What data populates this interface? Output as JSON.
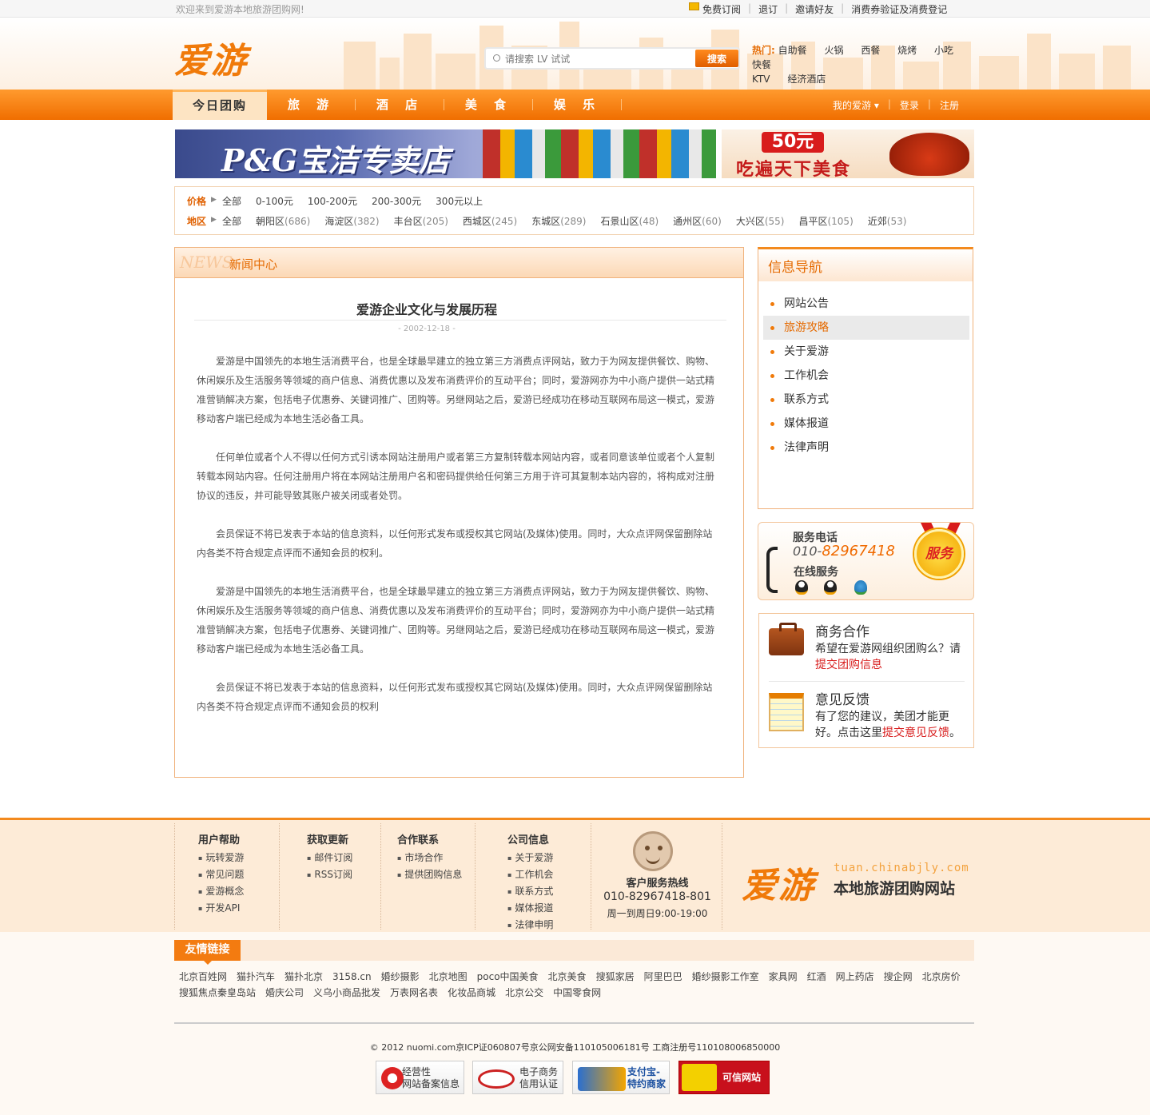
{
  "topbar": {
    "welcome": "欢迎来到爱游本地旅游团购网!",
    "links": [
      "免费订阅",
      "退订",
      "邀请好友",
      "消费券验证及消费登记"
    ]
  },
  "header": {
    "logo": "爱游",
    "search_placeholder": "请搜索 LV 试试",
    "search_button": "搜索",
    "hot_label": "热门:",
    "hot_words": [
      "自助餐",
      "火锅",
      "西餐",
      "烧烤",
      "小吃",
      "快餐",
      "KTV",
      "经济酒店"
    ]
  },
  "nav": {
    "items": [
      "今日团购",
      "旅 游",
      "酒 店",
      "美 食",
      "娱 乐"
    ],
    "right": [
      "我的爱游 ▾",
      "登录",
      "注册"
    ]
  },
  "banners": {
    "left": "P&G宝洁专卖店",
    "right_price": "50元",
    "right_text": "吃遍天下美食"
  },
  "filter": {
    "price_label": "价格",
    "price_options": [
      "全部",
      "0-100元",
      "100-200元",
      "200-300元",
      "300元以上"
    ],
    "area_label": "地区",
    "area_options": [
      {
        "name": "全部",
        "count": ""
      },
      {
        "name": "朝阳区",
        "count": "(686)"
      },
      {
        "name": "海淀区",
        "count": "(382)"
      },
      {
        "name": "丰台区",
        "count": "(205)"
      },
      {
        "name": "西城区",
        "count": "(245)"
      },
      {
        "name": "东城区",
        "count": "(289)"
      },
      {
        "name": "石景山区",
        "count": "(48)"
      },
      {
        "name": "通州区",
        "count": "(60)"
      },
      {
        "name": "大兴区",
        "count": "(55)"
      },
      {
        "name": "昌平区",
        "count": "(105)"
      },
      {
        "name": "近郊",
        "count": "(53)"
      }
    ]
  },
  "news": {
    "en": "NEWS",
    "header": "新闻中心",
    "title": "爱游企业文化与发展历程",
    "date": "- 2002-12-18 -",
    "paragraphs": [
      "爱游是中国领先的本地生活消费平台，也是全球最早建立的独立第三方消费点评网站，致力于为网友提供餐饮、购物、休闲娱乐及生活服务等领域的商户信息、消费优惠以及发布消费评价的互动平台；同时，爱游网亦为中小商户提供一站式精准营销解决方案，包括电子优惠券、关键词推广、团购等。另继网站之后，爱游已经成功在移动互联网布局这一模式，爱游移动客户端已经成为本地生活必备工具。",
      "任何单位或者个人不得以任何方式引诱本网站注册用户或者第三方复制转载本网站内容，或者同意该单位或者个人复制转载本网站内容。任何注册用户将在本网站注册用户名和密码提供给任何第三方用于许可其复制本站内容的，将构成对注册协议的违反，并可能导致其账户被关闭或者处罚。",
      "会员保证不将已发表于本站的信息资料，以任何形式发布或授权其它网站(及媒体)使用。同时，大众点评网保留删除站内各类不符合规定点评而不通知会员的权利。",
      "爱游是中国领先的本地生活消费平台，也是全球最早建立的独立第三方消费点评网站，致力于为网友提供餐饮、购物、休闲娱乐及生活服务等领域的商户信息、消费优惠以及发布消费评价的互动平台；同时，爱游网亦为中小商户提供一站式精准营销解决方案，包括电子优惠券、关键词推广、团购等。另继网站之后，爱游已经成功在移动互联网布局这一模式，爱游移动客户端已经成为本地生活必备工具。",
      "会员保证不将已发表于本站的信息资料，以任何形式发布或授权其它网站(及媒体)使用。同时，大众点评网保留删除站内各类不符合规定点评而不通知会员的权利"
    ]
  },
  "info_nav": {
    "title": "信息导航",
    "items": [
      "网站公告",
      "旅游攻略",
      "关于爱游",
      "工作机会",
      "联系方式",
      "媒体报道",
      "法律声明"
    ],
    "selected": "旅游攻略"
  },
  "service": {
    "phone_label": "服务电话",
    "phone_prefix": "010-",
    "phone_number": "82967418",
    "online_label": "在线服务",
    "medal": "服务"
  },
  "coop": {
    "biz_title": "商务合作",
    "biz_text": "希望在爱游网组织团购么？请",
    "biz_link": "提交团购信息",
    "fb_title": "意见反馈",
    "fb_text": "有了您的建议，美团才能更好。点击这里",
    "fb_link": "提交意见反馈",
    "fb_end": "。"
  },
  "footer": {
    "cols": [
      {
        "title": "用户帮助",
        "items": [
          "玩转爱游",
          "常见问题",
          "爱游概念",
          "开发API"
        ]
      },
      {
        "title": "获取更新",
        "items": [
          "邮件订阅",
          "RSS订阅"
        ]
      },
      {
        "title": "合作联系",
        "items": [
          "市场合作",
          "提供团购信息"
        ]
      },
      {
        "title": "公司信息",
        "items": [
          "关于爱游",
          "工作机会",
          "联系方式",
          "媒体报道",
          "法律申明"
        ]
      }
    ],
    "hotline_title": "客户服务热线",
    "hotline_number": "010-82967418-801",
    "hotline_hours": "周一到周日9:00-19:00",
    "logo": "爱游",
    "domain": "tuan.chinabjly.com",
    "slogan": "本地旅游团购网站"
  },
  "friend_links": {
    "title": "友情链接",
    "links": [
      "北京百姓网",
      "猫扑汽车",
      "猫扑北京",
      "3158.cn",
      "婚纱摄影",
      "北京地图",
      "poco中国美食",
      "北京美食",
      "搜狐家居",
      "阿里巴巴",
      "婚纱摄影工作室",
      "家具网",
      "红酒",
      "网上药店",
      "搜企网",
      "北京房价",
      "搜狐焦点秦皇岛站",
      "婚庆公司",
      "义乌小商品批发",
      "万表网名表",
      "化妆品商城",
      "北京公交",
      "中国零食网"
    ]
  },
  "copyright": "© 2012 nuomi.com京ICP证060807号京公网安备110105006181号 工商注册号110108006850000",
  "badges": [
    {
      "line1": "经营性",
      "line2": "网站备案信息"
    },
    {
      "line1": "电子商务",
      "line2": "信用认证"
    },
    {
      "line1": "支付宝-",
      "line2": "特约商家"
    },
    {
      "line1": "可信网站",
      "line2": ""
    }
  ]
}
